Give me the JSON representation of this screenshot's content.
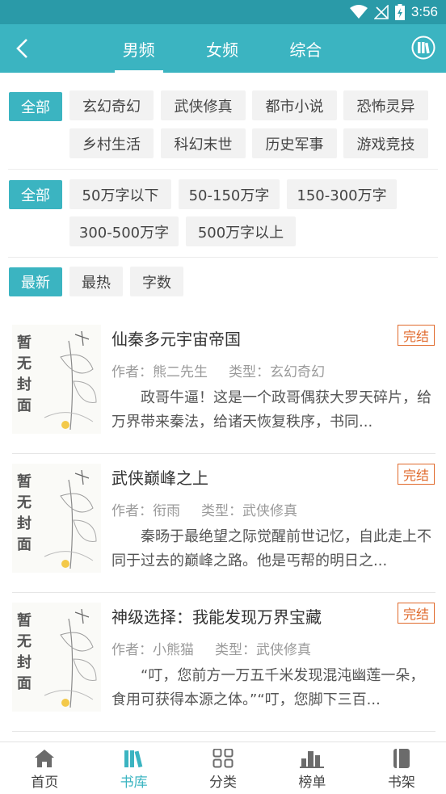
{
  "status_bar": {
    "time": "3:56"
  },
  "header": {
    "tabs": [
      {
        "label": "男频",
        "active": true
      },
      {
        "label": "女频",
        "active": false
      },
      {
        "label": "综合",
        "active": false
      }
    ]
  },
  "filters": {
    "category": {
      "selected": "全部",
      "options": [
        "玄幻奇幻",
        "武侠修真",
        "都市小说",
        "恐怖灵异",
        "乡村生活",
        "科幻末世",
        "历史军事",
        "游戏竞技"
      ]
    },
    "word_count": {
      "selected": "全部",
      "options": [
        "50万字以下",
        "50-150万字",
        "150-300万字",
        "300-500万字",
        "500万字以上"
      ]
    },
    "sort": {
      "selected": "最新",
      "options": [
        "最热",
        "字数"
      ]
    }
  },
  "books": [
    {
      "cover_text": "暂无封面",
      "title": "仙秦多元宇宙帝国",
      "status": "完结",
      "author": "作者：熊二先生",
      "genre": "类型：玄幻奇幻",
      "description": "政哥牛逼！这是一个政哥偶获大罗天碎片，给万界带来秦法，给诸天恢复秩序，书同..."
    },
    {
      "cover_text": "暂无封面",
      "title": "武侠巅峰之上",
      "status": "完结",
      "author": "作者：衔雨",
      "genre": "类型：武侠修真",
      "description": "秦旸于最绝望之际觉醒前世记忆，自此走上不同于过去的巅峰之路。他是丐帮的明日之..."
    },
    {
      "cover_text": "暂无封面",
      "title": "神级选择：我能发现万界宝藏",
      "status": "完结",
      "author": "作者：小熊猫",
      "genre": "类型：武侠修真",
      "description": "“叮，您前方一万五千米发现混沌幽莲一朵，食用可获得本源之体。”“叮，您脚下三百..."
    }
  ],
  "bottom_nav": [
    {
      "label": "首页",
      "icon": "home-icon",
      "active": false
    },
    {
      "label": "书库",
      "icon": "library-icon",
      "active": true
    },
    {
      "label": "分类",
      "icon": "grid-icon",
      "active": false
    },
    {
      "label": "榜单",
      "icon": "ranking-icon",
      "active": false
    },
    {
      "label": "书架",
      "icon": "bookshelf-icon",
      "active": false
    }
  ],
  "colors": {
    "accent": "#3bb4c1",
    "status_bar": "#2a9aa8",
    "badge": "#e06a2c"
  }
}
